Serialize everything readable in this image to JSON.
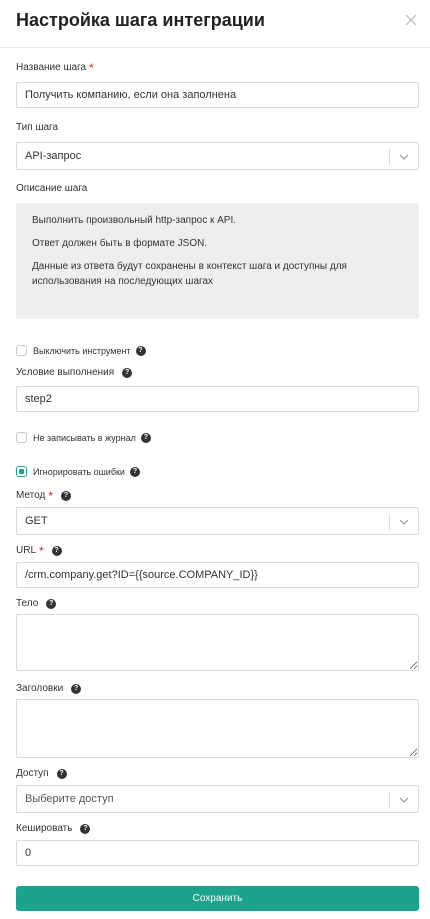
{
  "header": {
    "title": "Настройка шага интеграции"
  },
  "fields": {
    "step_name": {
      "label": "Название шага",
      "value": "Получить компанию, если она заполнена"
    },
    "step_type": {
      "label": "Тип шага",
      "value": "API-запрос"
    },
    "step_description": {
      "label": "Описание шага",
      "lines": [
        "Выполнить произвольный http-запрос к API.",
        "Ответ должен быть в формате JSON.",
        "Данные из ответа будут сохранены в контекст шага и доступны для использования на последующих шагах"
      ]
    },
    "disable_tool": {
      "label": "Выключить инструмент",
      "checked": false
    },
    "condition": {
      "label": "Условие выполнения",
      "value": "step2"
    },
    "no_log": {
      "label": "Не записывать в журнал",
      "checked": false
    },
    "ignore_errors": {
      "label": "Игнорировать ошибки",
      "checked": true
    },
    "method": {
      "label": "Метод",
      "value": "GET"
    },
    "url": {
      "label": "URL",
      "value": "/crm.company.get?ID={{source.COMPANY_ID}}"
    },
    "body": {
      "label": "Тело",
      "value": ""
    },
    "headers": {
      "label": "Заголовки",
      "value": ""
    },
    "access": {
      "label": "Доступ",
      "placeholder": "Выберите доступ"
    },
    "cache": {
      "label": "Кешировать",
      "value": "0"
    }
  },
  "icons": {
    "close": "close-icon",
    "help": "question-circle-icon",
    "dropdown": "chevron-down-icon"
  },
  "colors": {
    "accent": "#1ba48b",
    "required": "#e02020",
    "description_bg": "#eeeeee"
  },
  "actions": {
    "save_label": "Сохранить"
  }
}
